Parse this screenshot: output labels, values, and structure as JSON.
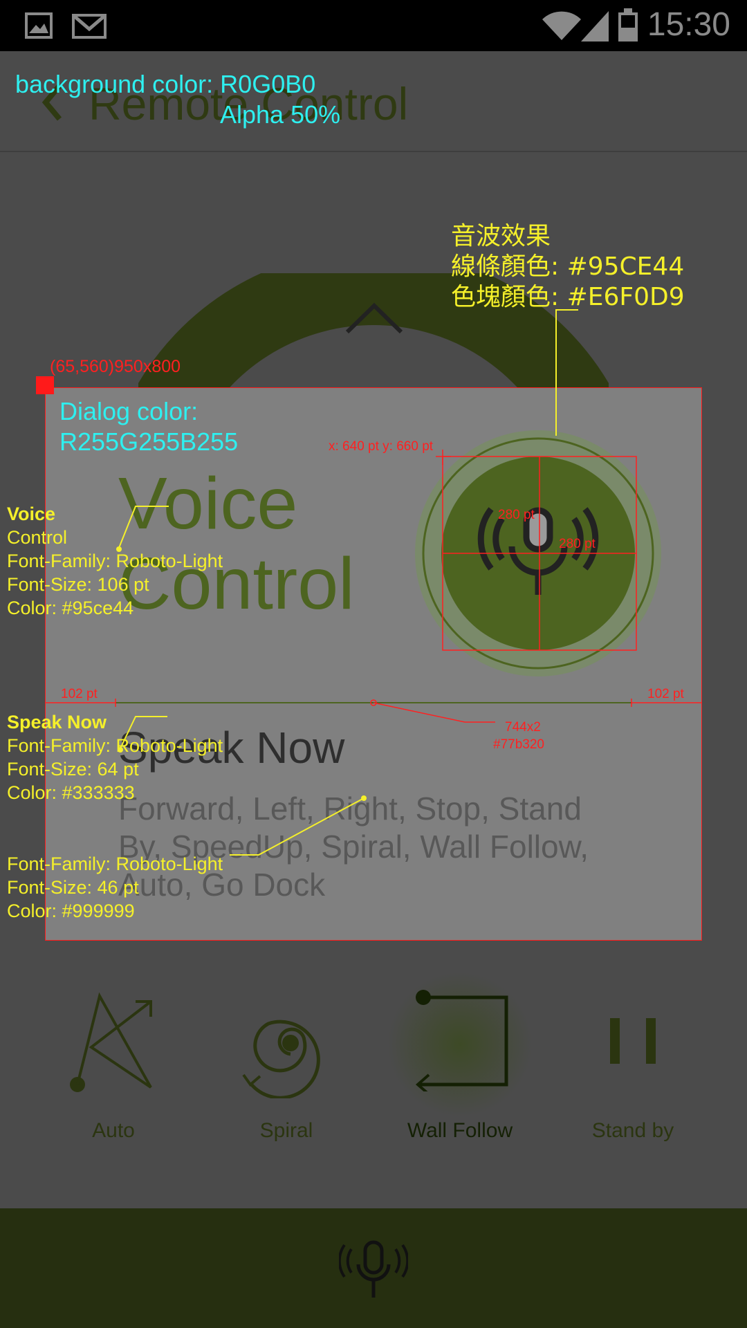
{
  "status_bar": {
    "time": "15:30",
    "icons": [
      "image-icon",
      "gmail-icon",
      "wifi-icon",
      "signal-icon",
      "battery-icon"
    ]
  },
  "app": {
    "title": "Remote Control",
    "modes": [
      {
        "label": "Auto",
        "icon": "auto-arrows-icon"
      },
      {
        "label": "Spiral",
        "icon": "spiral-icon"
      },
      {
        "label": "Wall Follow",
        "icon": "wall-follow-icon"
      },
      {
        "label": "Stand by",
        "icon": "pause-icon"
      }
    ],
    "bottom_icon": "microphone-icon"
  },
  "dialog": {
    "title": "Voice\nControl",
    "speak_now": "Speak Now",
    "commands": "Forward, Left, Right, Stop, Stand By, SpeedUp, Spiral, Wall Follow, Auto, Go Dock"
  },
  "annotations": {
    "background_color": "background color: R0G0B0",
    "background_alpha": "Alpha 50%",
    "dialog_color_line1": "Dialog color:",
    "dialog_color_line2": "R255G255B255",
    "dialog_rect": "(65,560)950x800",
    "wave_title": "音波效果",
    "wave_line_color": "線條顏色: #95CE44",
    "wave_block_color": "色塊顏色: #E6F0D9",
    "mic_position": "x: 640 pt y: 660 pt",
    "mic_size_w": "280 pt",
    "mic_size_h": "280 pt",
    "margin_left": "102 pt",
    "margin_right": "102 pt",
    "divider_size": "744x2",
    "divider_color": "#77b320",
    "voice_spec": {
      "heading": "Voice",
      "line2": "Control",
      "family": "Font-Family: Roboto-Light",
      "size": "Font-Size: 106 pt",
      "color": "Color: #95ce44"
    },
    "speak_spec": {
      "heading": "Speak Now",
      "family": "Font-Family: Roboto-Light",
      "size": "Font-Size: 64 pt",
      "color": "Color: #333333"
    },
    "commands_spec": {
      "family": "Font-Family: Roboto-Light",
      "size": "Font-Size: 46 pt",
      "color": "Color: #999999"
    }
  },
  "colors": {
    "accent_green": "#95ce44",
    "divider": "#77b320",
    "annotation_red": "#ff2020",
    "annotation_yellow": "#f5f02a",
    "annotation_cyan": "#2ef0f0"
  }
}
